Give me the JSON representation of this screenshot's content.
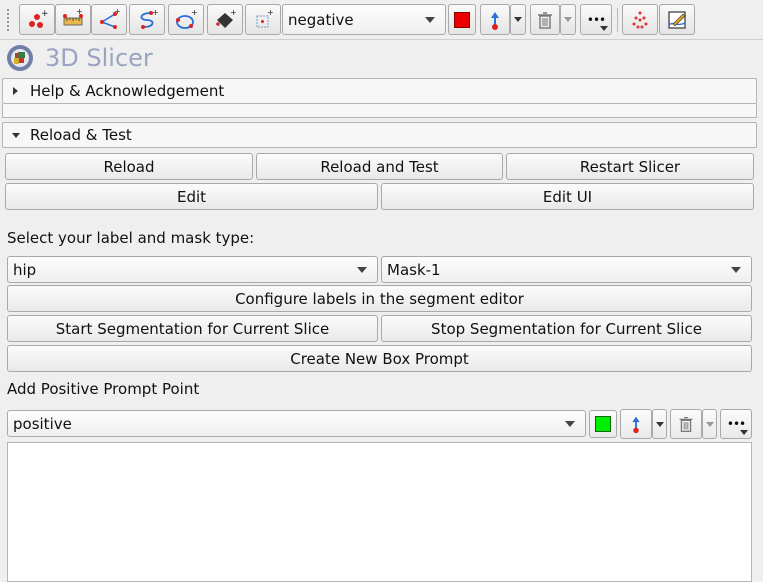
{
  "toolbar": {
    "icons": [
      "point-list-icon",
      "ruler-icon",
      "angle-icon",
      "curve-icon",
      "closed-curve-icon",
      "plane-icon",
      "roi-icon"
    ],
    "markup_select": "negative",
    "color": "#ee0000",
    "right_icons": [
      "place-mode-icon",
      "delete-icon",
      "more-icon",
      "fiducial-icon",
      "annotation-edit-icon"
    ]
  },
  "header": {
    "title": "3D Slicer"
  },
  "sections": {
    "help": "Help & Acknowledgement",
    "reload": "Reload & Test"
  },
  "reload_buttons": {
    "reload": "Reload",
    "reload_test": "Reload and Test",
    "restart": "Restart Slicer",
    "edit": "Edit",
    "edit_ui": "Edit UI"
  },
  "segmentation": {
    "select_label": "Select your label and mask type:",
    "label_value": "hip",
    "mask_value": "Mask-1",
    "configure": "Configure labels in the segment editor",
    "start": "Start Segmentation for Current Slice",
    "stop": "Stop Segmentation for Current Slice",
    "box_prompt": "Create New Box Prompt",
    "positive_label": "Add Positive Prompt Point",
    "positive_value": "positive",
    "positive_color": "#00ee00"
  }
}
